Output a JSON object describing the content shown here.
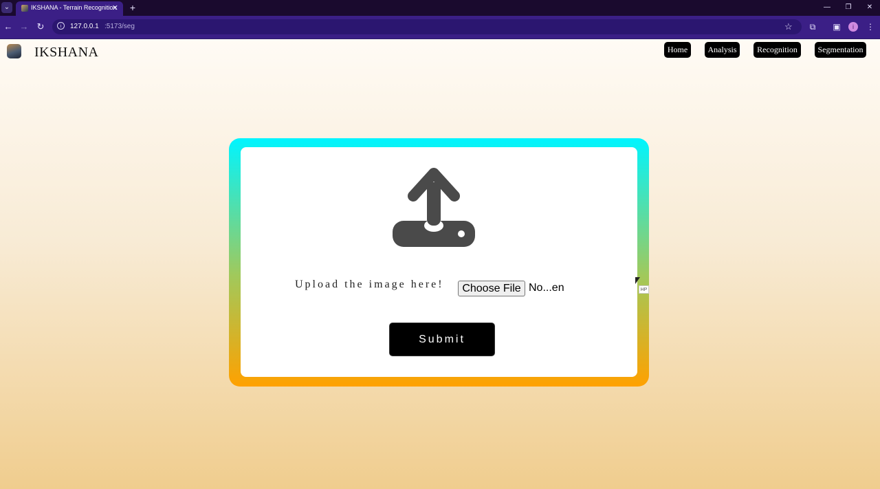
{
  "browser": {
    "tab_title": "IKSHANA - Terrain Recognition",
    "url_host": "127.0.0.1",
    "url_path": ":5173/seg",
    "icons": {
      "tab_menu": "chevron-down-icon",
      "close_tab": "close-icon",
      "new_tab": "plus-icon",
      "back": "back-arrow-icon",
      "forward": "forward-arrow-icon",
      "reload": "reload-icon",
      "site_info": "info-icon",
      "bookmark": "star-icon",
      "extensions": "puzzle-icon",
      "side_panel": "sidebar-icon",
      "profile": "avatar-icon",
      "menu": "kebab-menu-icon"
    },
    "profile_initial": "i"
  },
  "site": {
    "brand": "IKSHANA",
    "nav": [
      "Home",
      "Analysis",
      "Recognition",
      "Segmentation"
    ]
  },
  "upload": {
    "label": "Upload the image here!",
    "choose_file": "Choose File",
    "file_status": "No...en",
    "submit": "Submit",
    "icon": "upload-icon"
  },
  "overlay": {
    "hp_badge": "HP"
  },
  "colors": {
    "chrome_dark": "#1a0a2e",
    "chrome_toolbar": "#3b1f86",
    "border_top": "#00f5ff",
    "border_bottom": "#ffa100",
    "icon_gray": "#4a4a4a"
  }
}
